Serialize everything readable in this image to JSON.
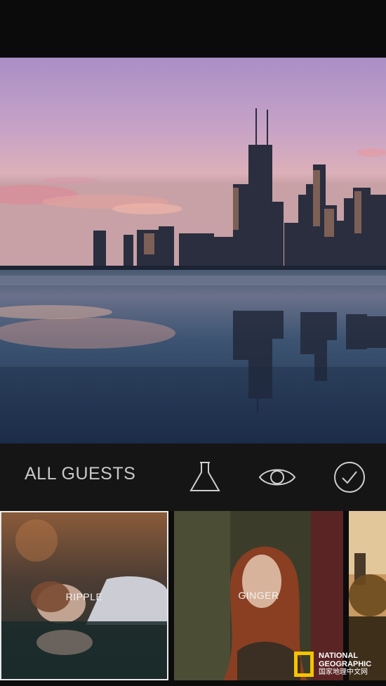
{
  "toolbar": {
    "guests_label": "ALL GUESTS",
    "icons": [
      "flask-icon",
      "eye-icon",
      "checkmark-icon"
    ]
  },
  "filters": [
    {
      "label": "RIPPLE",
      "selected": true
    },
    {
      "label": "GINGER",
      "selected": false
    },
    {
      "label": "",
      "selected": false
    }
  ],
  "watermark": {
    "line1": "NATIONAL",
    "line2": "GEOGRAPHIC",
    "line3": "国家地理中文网"
  },
  "colors": {
    "background": "#131313",
    "text": "#c9c9c9",
    "selected_border": "#e9e9e9",
    "natgeo_yellow": "#f5c400"
  }
}
